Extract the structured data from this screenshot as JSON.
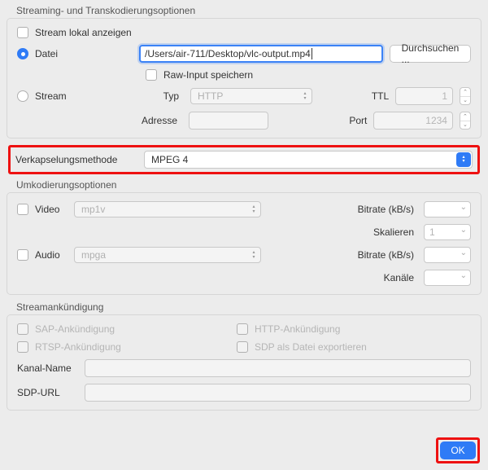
{
  "streaming": {
    "title": "Streaming- und Transkodierungsoptionen",
    "show_local": "Stream lokal anzeigen",
    "file_label": "Datei",
    "file_path": "/Users/air-711/Desktop/vlc-output.mp4",
    "browse": "Durchsuchen ...",
    "raw_input": "Raw-Input speichern",
    "stream_label": "Stream",
    "type_label": "Typ",
    "type_value": "HTTP",
    "ttl_label": "TTL",
    "ttl_value": "1",
    "address_label": "Adresse",
    "port_label": "Port",
    "port_placeholder": "1234"
  },
  "encap": {
    "label": "Verkapselungsmethode",
    "value": "MPEG 4"
  },
  "transcoding": {
    "title": "Umkodierungsoptionen",
    "video_label": "Video",
    "video_codec": "mp1v",
    "video_bitrate_label": "Bitrate (kB/s)",
    "video_scale_label": "Skalieren",
    "video_scale_value": "1",
    "audio_label": "Audio",
    "audio_codec": "mpga",
    "audio_bitrate_label": "Bitrate (kB/s)",
    "audio_channels_label": "Kanäle"
  },
  "announce": {
    "title": "Streamankündigung",
    "sap": "SAP-Ankündigung",
    "http": "HTTP-Ankündigung",
    "rtsp": "RTSP-Ankündigung",
    "sdp_export": "SDP als Datei exportieren",
    "channel_name": "Kanal-Name",
    "sdp_url": "SDP-URL"
  },
  "ok": "OK"
}
